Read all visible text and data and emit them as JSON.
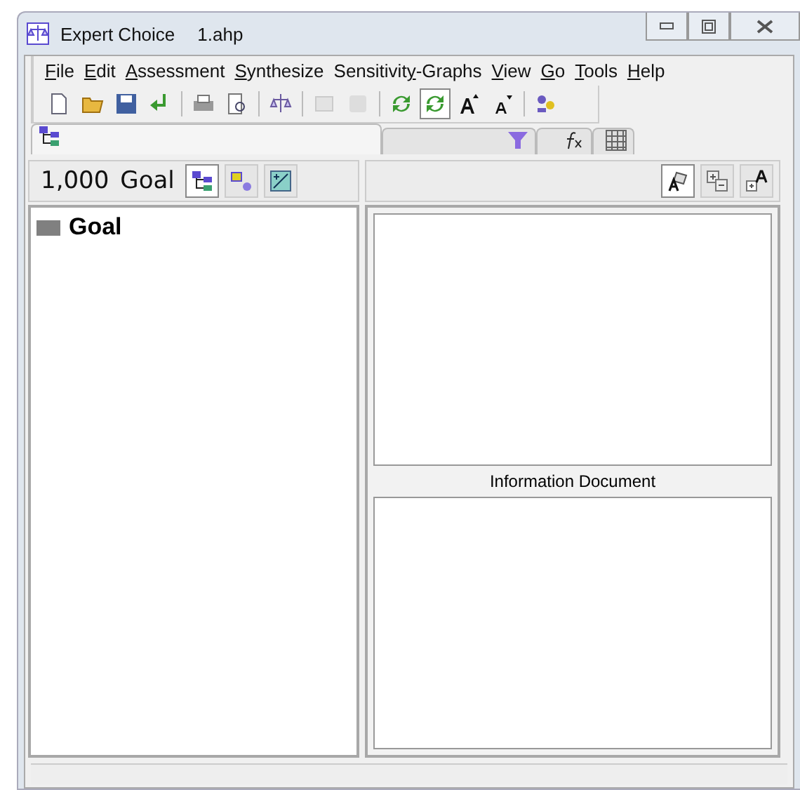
{
  "window": {
    "title": "Expert Choice",
    "file": "1.ahp"
  },
  "menu": [
    {
      "key": "F",
      "post": "ile"
    },
    {
      "key": "E",
      "post": "dit"
    },
    {
      "key": "A",
      "post": "ssessment"
    },
    {
      "key": "S",
      "post": "ynthesize"
    },
    {
      "pre": "Sensitivit",
      "key": "y",
      "post": "-Graphs"
    },
    {
      "key": "V",
      "post": "iew"
    },
    {
      "key": "G",
      "post": "o"
    },
    {
      "key": "T",
      "post": "ools"
    },
    {
      "key": "H",
      "post": "elp"
    }
  ],
  "toolbar": [
    {
      "kind": "new",
      "disabled": false,
      "pressed": false
    },
    {
      "kind": "open",
      "disabled": false,
      "pressed": false
    },
    {
      "kind": "save",
      "disabled": false,
      "pressed": false
    },
    {
      "kind": "enter",
      "disabled": false,
      "pressed": false
    },
    {
      "kind": "sep"
    },
    {
      "kind": "print",
      "disabled": false,
      "pressed": false
    },
    {
      "kind": "preview",
      "disabled": false,
      "pressed": false
    },
    {
      "kind": "sep"
    },
    {
      "kind": "balance",
      "disabled": false,
      "pressed": false
    },
    {
      "kind": "sep"
    },
    {
      "kind": "notes",
      "disabled": true,
      "pressed": false
    },
    {
      "kind": "disk",
      "disabled": true,
      "pressed": false
    },
    {
      "kind": "sep"
    },
    {
      "kind": "cycle",
      "disabled": false,
      "pressed": false
    },
    {
      "kind": "cycle",
      "disabled": false,
      "pressed": true
    },
    {
      "kind": "fontup",
      "disabled": false,
      "pressed": false
    },
    {
      "kind": "fontdown",
      "disabled": false,
      "pressed": false
    },
    {
      "kind": "sep"
    },
    {
      "kind": "people",
      "disabled": false,
      "pressed": false
    }
  ],
  "tabs": [
    {
      "kind": "tree",
      "selected": true
    },
    {
      "kind": "funnel",
      "selected": false
    },
    {
      "kind": "formula",
      "selected": false
    },
    {
      "kind": "grid",
      "selected": false
    }
  ],
  "left_header": {
    "priority": "1,000",
    "node": "Goal",
    "buttons": [
      {
        "kind": "tree",
        "selected": true
      },
      {
        "kind": "nodes",
        "selected": false
      },
      {
        "kind": "chart",
        "selected": false
      }
    ]
  },
  "tree": [
    {
      "label": "Goal"
    }
  ],
  "right_header": {
    "buttons": [
      {
        "kind": "note",
        "selected": true
      },
      {
        "kind": "expand",
        "selected": false
      },
      {
        "kind": "addfont",
        "selected": false
      }
    ]
  },
  "info": {
    "title": "Information Document"
  }
}
